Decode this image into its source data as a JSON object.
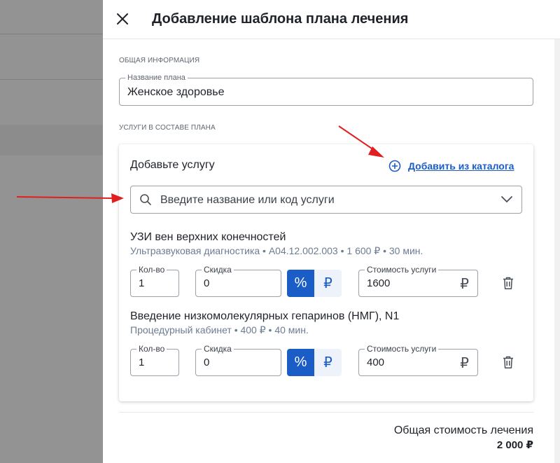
{
  "drawer": {
    "title": "Добавление шаблона плана лечения",
    "section_general": "ОБЩАЯ ИНФОРМАЦИЯ",
    "plan_name_label": "Название плана",
    "plan_name_value": "Женское здоровье",
    "section_services": "УСЛУГИ В СОСТАВЕ ПЛАНА"
  },
  "card": {
    "title": "Добавьте услугу",
    "add_from_catalog": "Добавить из каталога",
    "search_placeholder": "Введите название или код услуги"
  },
  "services": [
    {
      "name": "УЗИ вен верхних конечностей",
      "meta": "Ультразвуковая диагностика • A04.12.002.003 • 1 600 ₽ • 30 мин.",
      "qty_label": "Кол-во",
      "qty": "1",
      "discount_label": "Скидка",
      "discount": "0",
      "percent_symbol": "%",
      "rub_symbol": "₽",
      "cost_label": "Стоимость услуги",
      "cost": "1600"
    },
    {
      "name": "Введение низкомолекулярных гепаринов (НМГ), N1",
      "meta": "Процедурный кабинет • 400 ₽ • 40 мин.",
      "qty_label": "Кол-во",
      "qty": "1",
      "discount_label": "Скидка",
      "discount": "0",
      "percent_symbol": "%",
      "rub_symbol": "₽",
      "cost_label": "Стоимость услуги",
      "cost": "400"
    }
  ],
  "footer": {
    "total_label": "Общая стоимость лечения",
    "total_value": "2 000 ₽"
  },
  "colors": {
    "accent": "#1b5dc6",
    "annotation_arrow": "#e02020"
  },
  "icons": [
    "close-icon",
    "add-circle-icon",
    "search-icon",
    "chevron-down-icon",
    "trash-icon"
  ]
}
